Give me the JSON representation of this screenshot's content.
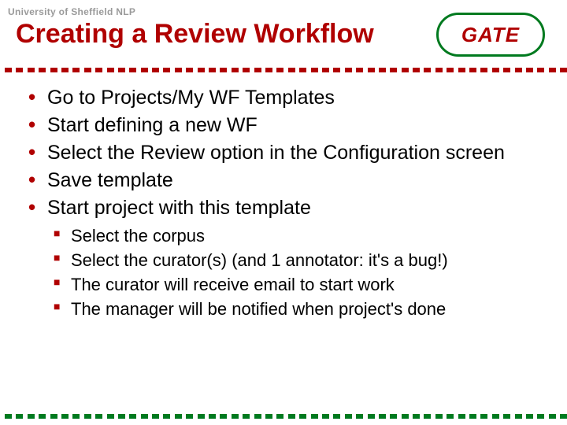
{
  "header": "University of Sheffield NLP",
  "title": "Creating a Review Workflow",
  "logo": {
    "text": "GATE"
  },
  "bullets": [
    {
      "text": "Go to Projects/My WF Templates"
    },
    {
      "text": "Start defining a new WF"
    },
    {
      "text": "Select the Review option in the Configuration screen"
    },
    {
      "text": "Save template"
    },
    {
      "text": "Start project with this template"
    }
  ],
  "subbullets": [
    {
      "text": "Select the corpus"
    },
    {
      "text": "Select the curator(s) (and 1 annotator: it's a bug!)"
    },
    {
      "text": "The curator will receive email to start work"
    },
    {
      "text": "The manager will be notified when project's done"
    }
  ]
}
